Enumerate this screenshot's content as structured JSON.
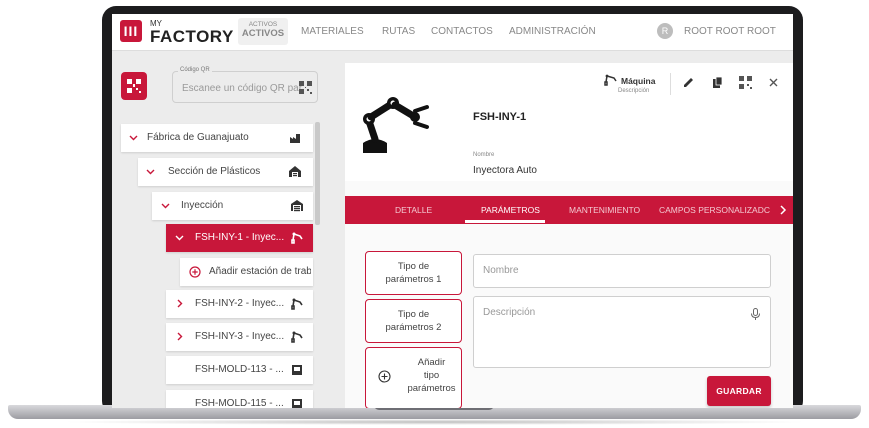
{
  "header": {
    "logo_small": "MY",
    "logo_big": "FACTORY",
    "logo_glyph": "III",
    "nav_active_small": "ACTIVOS",
    "nav_active_big": "ACTIVOS",
    "nav_items": [
      "MATERIALES",
      "RUTAS",
      "CONTACTOS",
      "ADMINISTRACIÓN"
    ],
    "user_initial": "R",
    "user_name": "ROOT ROOT ROOT"
  },
  "qr": {
    "label": "Código QR",
    "placeholder": "Escanee un código QR par"
  },
  "tree": [
    {
      "label": "Fábrica de Guanajuato",
      "icon": "factory-icon",
      "chevron": "down"
    },
    {
      "label": "Sección de Plásticos",
      "icon": "house-icon",
      "chevron": "down"
    },
    {
      "label": "Inyección",
      "icon": "warehouse-icon",
      "chevron": "down"
    },
    {
      "label": "FSH-INY-1 - Inyec...",
      "icon": "robot-arm-icon",
      "chevron": "down",
      "selected": true
    },
    {
      "label": "Añadir estación de traba",
      "icon": "add-circle-icon"
    },
    {
      "label": "FSH-INY-2 - Inyec...",
      "icon": "robot-arm-icon",
      "chevron": "right"
    },
    {
      "label": "FSH-INY-3 - Inyec...",
      "icon": "robot-arm-icon",
      "chevron": "right"
    },
    {
      "label": "FSH-MOLD-113 - ...",
      "icon": "container-icon"
    },
    {
      "label": "FSH-MOLD-115 - ...",
      "icon": "container-icon"
    }
  ],
  "detail": {
    "title": "FSH-INY-1",
    "name_label": "Nombre",
    "name_value": "Inyectora Auto",
    "type_label": "Máquina",
    "type_sub": "Descripción",
    "tabs": [
      "DETALLE",
      "PARÁMETROS",
      "MANTENIMIENTO",
      "CAMPOS PERSONALIZADC"
    ],
    "active_tab": "PARÁMETROS",
    "param_types": [
      {
        "line1": "Tipo de",
        "line2": "parámetros 1"
      },
      {
        "line1": "Tipo de",
        "line2": "parámetros 2"
      }
    ],
    "add_type": {
      "line1": "Añadir",
      "line2": "tipo",
      "line3": "parámetros"
    },
    "field_name_placeholder": "Nombre",
    "field_desc_placeholder": "Descripción",
    "save_label": "GUARDAR"
  },
  "colors": {
    "accent": "#c8173a",
    "background": "#ececec"
  }
}
